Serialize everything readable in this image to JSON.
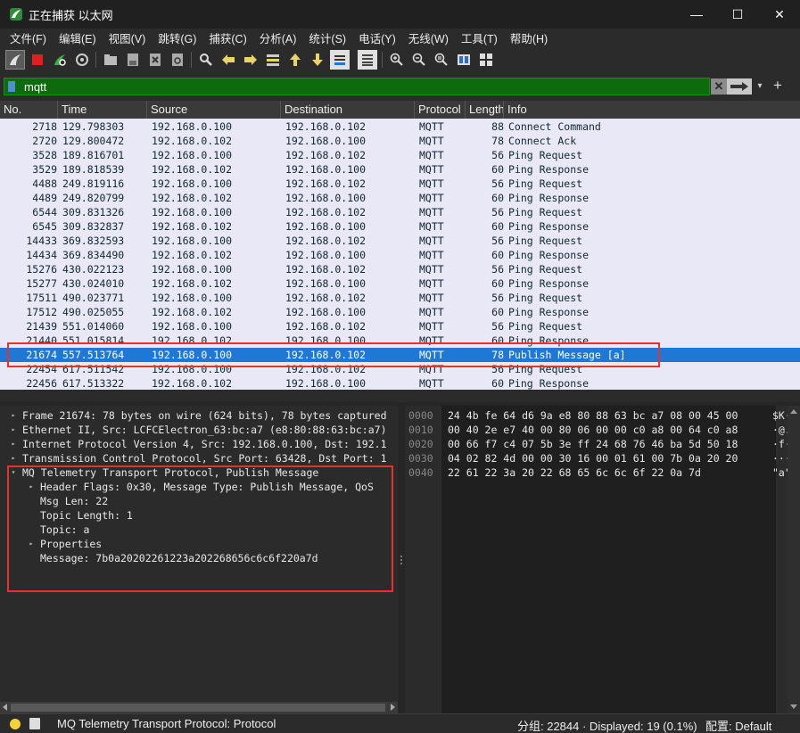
{
  "window": {
    "title": "正在捕获 以太网",
    "minimize": "—",
    "maximize": "☐",
    "close": "✕"
  },
  "menu": [
    "文件(F)",
    "编辑(E)",
    "视图(V)",
    "跳转(G)",
    "捕获(C)",
    "分析(A)",
    "统计(S)",
    "电话(Y)",
    "无线(W)",
    "工具(T)",
    "帮助(H)"
  ],
  "toolbar": {
    "icons": [
      "shark-fin-start-icon",
      "stop-capture-icon",
      "restart-capture-icon",
      "capture-options-icon",
      "open-file-icon",
      "save-file-icon",
      "close-file-icon",
      "reload-file-icon",
      "find-packet-icon",
      "go-back-icon",
      "go-forward-icon",
      "go-to-packet-icon",
      "go-first-icon",
      "go-last-icon",
      "auto-scroll-icon",
      "colorize-icon",
      "zoom-in-icon",
      "zoom-out-icon",
      "zoom-normal-icon",
      "resize-columns-icon",
      "layout-icon"
    ]
  },
  "filter": {
    "value": "mqtt",
    "clear": "✕",
    "dropdown": "▾",
    "add": "+"
  },
  "packet_list": {
    "columns": [
      "No.",
      "Time",
      "Source",
      "Destination",
      "Protocol",
      "Length",
      "Info"
    ],
    "rows": [
      {
        "no": "2718",
        "time": "129.798303",
        "src": "192.168.0.100",
        "dst": "192.168.0.102",
        "proto": "MQTT",
        "len": "88",
        "info": "Connect Command"
      },
      {
        "no": "2720",
        "time": "129.800472",
        "src": "192.168.0.102",
        "dst": "192.168.0.100",
        "proto": "MQTT",
        "len": "78",
        "info": "Connect Ack"
      },
      {
        "no": "3528",
        "time": "189.816701",
        "src": "192.168.0.100",
        "dst": "192.168.0.102",
        "proto": "MQTT",
        "len": "56",
        "info": "Ping Request"
      },
      {
        "no": "3529",
        "time": "189.818539",
        "src": "192.168.0.102",
        "dst": "192.168.0.100",
        "proto": "MQTT",
        "len": "60",
        "info": "Ping Response"
      },
      {
        "no": "4488",
        "time": "249.819116",
        "src": "192.168.0.100",
        "dst": "192.168.0.102",
        "proto": "MQTT",
        "len": "56",
        "info": "Ping Request"
      },
      {
        "no": "4489",
        "time": "249.820799",
        "src": "192.168.0.102",
        "dst": "192.168.0.100",
        "proto": "MQTT",
        "len": "60",
        "info": "Ping Response"
      },
      {
        "no": "6544",
        "time": "309.831326",
        "src": "192.168.0.100",
        "dst": "192.168.0.102",
        "proto": "MQTT",
        "len": "56",
        "info": "Ping Request"
      },
      {
        "no": "6545",
        "time": "309.832837",
        "src": "192.168.0.102",
        "dst": "192.168.0.100",
        "proto": "MQTT",
        "len": "60",
        "info": "Ping Response"
      },
      {
        "no": "14433",
        "time": "369.832593",
        "src": "192.168.0.100",
        "dst": "192.168.0.102",
        "proto": "MQTT",
        "len": "56",
        "info": "Ping Request"
      },
      {
        "no": "14434",
        "time": "369.834490",
        "src": "192.168.0.102",
        "dst": "192.168.0.100",
        "proto": "MQTT",
        "len": "60",
        "info": "Ping Response"
      },
      {
        "no": "15276",
        "time": "430.022123",
        "src": "192.168.0.100",
        "dst": "192.168.0.102",
        "proto": "MQTT",
        "len": "56",
        "info": "Ping Request"
      },
      {
        "no": "15277",
        "time": "430.024010",
        "src": "192.168.0.102",
        "dst": "192.168.0.100",
        "proto": "MQTT",
        "len": "60",
        "info": "Ping Response"
      },
      {
        "no": "17511",
        "time": "490.023771",
        "src": "192.168.0.100",
        "dst": "192.168.0.102",
        "proto": "MQTT",
        "len": "56",
        "info": "Ping Request"
      },
      {
        "no": "17512",
        "time": "490.025055",
        "src": "192.168.0.102",
        "dst": "192.168.0.100",
        "proto": "MQTT",
        "len": "60",
        "info": "Ping Response"
      },
      {
        "no": "21439",
        "time": "551.014060",
        "src": "192.168.0.100",
        "dst": "192.168.0.102",
        "proto": "MQTT",
        "len": "56",
        "info": "Ping Request"
      },
      {
        "no": "21440",
        "time": "551.015814",
        "src": "192.168.0.102",
        "dst": "192.168.0.100",
        "proto": "MQTT",
        "len": "60",
        "info": "Ping Response"
      },
      {
        "no": "21674",
        "time": "557.513764",
        "src": "192.168.0.100",
        "dst": "192.168.0.102",
        "proto": "MQTT",
        "len": "78",
        "info": "Publish Message [a]",
        "selected": true
      },
      {
        "no": "22454",
        "time": "617.511542",
        "src": "192.168.0.100",
        "dst": "192.168.0.102",
        "proto": "MQTT",
        "len": "56",
        "info": "Ping Request"
      },
      {
        "no": "22456",
        "time": "617.513322",
        "src": "192.168.0.102",
        "dst": "192.168.0.100",
        "proto": "MQTT",
        "len": "60",
        "info": "Ping Response"
      }
    ]
  },
  "details": [
    {
      "arrow": "▸",
      "indent": 0,
      "text": "Frame 21674: 78 bytes on wire (624 bits), 78 bytes captured"
    },
    {
      "arrow": "▸",
      "indent": 0,
      "text": "Ethernet II, Src: LCFCElectron_63:bc:a7 (e8:80:88:63:bc:a7)"
    },
    {
      "arrow": "▸",
      "indent": 0,
      "text": "Internet Protocol Version 4, Src: 192.168.0.100, Dst: 192.1"
    },
    {
      "arrow": "▸",
      "indent": 0,
      "text": "Transmission Control Protocol, Src Port: 63428, Dst Port: 1"
    },
    {
      "arrow": "▾",
      "indent": 0,
      "text": "MQ Telemetry Transport Protocol, Publish Message"
    },
    {
      "arrow": "▸",
      "indent": 1,
      "text": "Header Flags: 0x30, Message Type: Publish Message, QoS"
    },
    {
      "arrow": "",
      "indent": 1,
      "text": "Msg Len: 22"
    },
    {
      "arrow": "",
      "indent": 1,
      "text": "Topic Length: 1"
    },
    {
      "arrow": "",
      "indent": 1,
      "text": "Topic: a"
    },
    {
      "arrow": "▸",
      "indent": 1,
      "text": "Properties"
    },
    {
      "arrow": "",
      "indent": 1,
      "text": "Message: 7b0a20202261223a202268656c6c6f220a7d"
    }
  ],
  "bytes": [
    {
      "off": "0000",
      "hex": "24 4b fe 64 d6 9a e8 80  88 63 bc a7 08 00 45 00",
      "asc": "$K·d"
    },
    {
      "off": "0010",
      "hex": "00 40 2e e7 40 00 80 06  00 00 c0 a8 00 64 c0 a8",
      "asc": "·@.·"
    },
    {
      "off": "0020",
      "hex": "00 66 f7 c4 07 5b 3e ff  24 68 76 46 ba 5d 50 18",
      "asc": "·f··"
    },
    {
      "off": "0030",
      "hex": "04 02 82 4d 00 00 30 16  00 01 61 00 7b 0a 20 20",
      "asc": "···M"
    },
    {
      "off": "0040",
      "hex": "22 61 22 3a 20 22 68 65  6c 6c 6f 22 0a 7d",
      "asc": "\"a\":"
    }
  ],
  "status": {
    "message": "MQ Telemetry Transport Protocol: Protocol",
    "packets": "分组: 22844 · Displayed: 19 (0.1%)",
    "profile": "配置: Default"
  }
}
